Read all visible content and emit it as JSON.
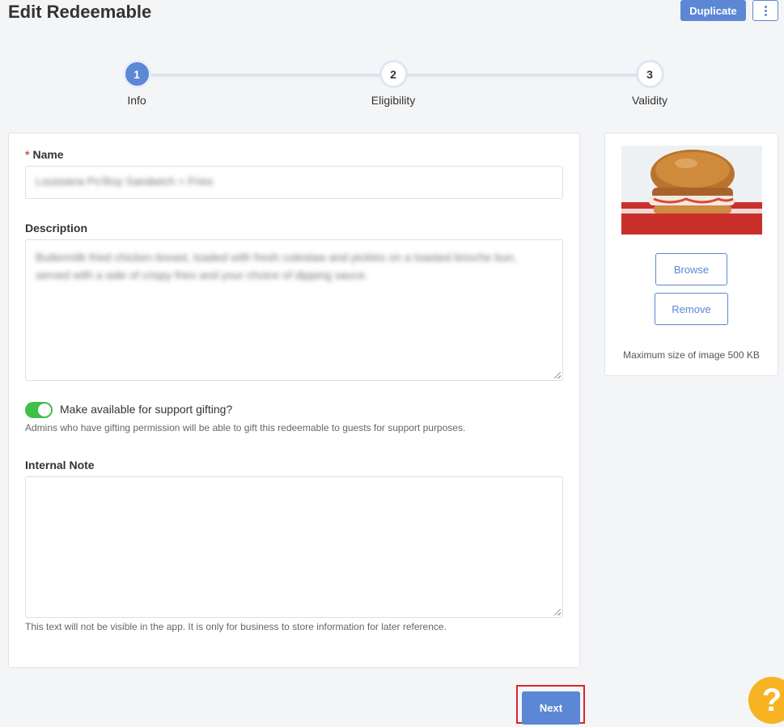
{
  "header": {
    "title": "Edit Redeemable",
    "duplicate_label": "Duplicate",
    "more_icon": "more-vertical-icon"
  },
  "stepper": {
    "steps": [
      {
        "number": "1",
        "label": "Info",
        "state": "active"
      },
      {
        "number": "2",
        "label": "Eligibility",
        "state": "idle"
      },
      {
        "number": "3",
        "label": "Validity",
        "state": "idle"
      }
    ]
  },
  "form": {
    "name": {
      "required_marker": "*",
      "label": "Name",
      "value": "Louisiana Po'Boy Sandwich + Fries"
    },
    "description": {
      "label": "Description",
      "value": "Buttermilk fried chicken breast, loaded with fresh coleslaw and pickles on a toasted brioche bun, served with a side of crispy fries and your choice of dipping sauce."
    },
    "support_gifting": {
      "enabled": true,
      "label": "Make available for support gifting?",
      "help": "Admins who have gifting permission will be able to gift this redeemable to guests for support purposes."
    },
    "internal_note": {
      "label": "Internal Note",
      "value": "",
      "help": "This text will not be visible in the app. It is only for business to store information for later reference."
    }
  },
  "image_panel": {
    "browse_label": "Browse",
    "remove_label": "Remove",
    "max_size_text": "Maximum size of image 500 KB"
  },
  "footer": {
    "next_label": "Next",
    "help_symbol": "?"
  },
  "colors": {
    "primary": "#5b87d4",
    "toggle_on": "#3fbf4a",
    "help_fab": "#f7b322",
    "highlight": "#d9262b"
  }
}
